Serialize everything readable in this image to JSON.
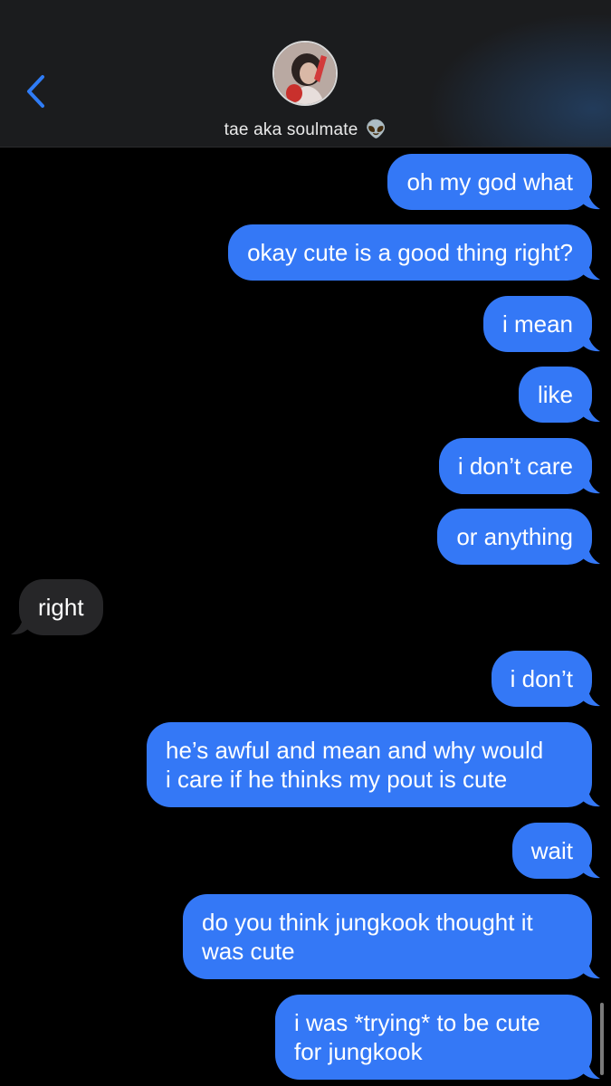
{
  "header": {
    "contact_name": "tae aka soulmate",
    "contact_emoji": "👽",
    "back_icon": "chevron-left-icon",
    "accent": "#2f7cf6"
  },
  "colors": {
    "sent": "#3478f6",
    "received": "#262628",
    "background": "#000000"
  },
  "messages": [
    {
      "from": "me",
      "text": "oh my god what"
    },
    {
      "from": "me",
      "text": "okay cute is a good thing right?"
    },
    {
      "from": "me",
      "text": "i mean"
    },
    {
      "from": "me",
      "text": "like"
    },
    {
      "from": "me",
      "text": "i don’t care"
    },
    {
      "from": "me",
      "text": "or anything"
    },
    {
      "from": "them",
      "text": "right"
    },
    {
      "from": "me",
      "text": "i don’t"
    },
    {
      "from": "me",
      "text": "he’s awful and mean and why would i care if he thinks my pout is cute"
    },
    {
      "from": "me",
      "text": "wait"
    },
    {
      "from": "me",
      "text": "do you think jungkook thought it was cute"
    },
    {
      "from": "me",
      "text": "i was *trying* to be cute for jungkook"
    }
  ]
}
